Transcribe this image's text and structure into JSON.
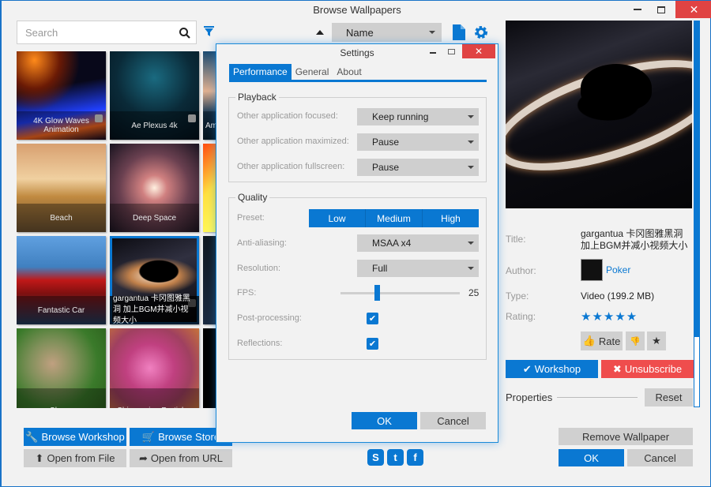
{
  "window": {
    "title": "Browse Wallpapers",
    "minimize_label": "–",
    "close_label": "✕"
  },
  "search": {
    "placeholder": "Search",
    "value": ""
  },
  "sort": {
    "selected": "Name"
  },
  "tiles": [
    {
      "label": "4K Glow Waves Animation",
      "workshop": true
    },
    {
      "label": "Ae Plexus 4k",
      "workshop": true
    },
    {
      "label": "Am...",
      "workshop": false
    },
    {
      "label": "Beach",
      "workshop": false
    },
    {
      "label": "Deep Space",
      "workshop": false
    },
    {
      "label": "",
      "workshop": false
    },
    {
      "label": "Fantastic Car",
      "workshop": false
    },
    {
      "label": "gargantua 卡冈图雅黑洞 加上BGM并减小视频大小",
      "workshop": true,
      "selected": true
    },
    {
      "label": "",
      "workshop": false
    },
    {
      "label": "Sheep",
      "workshop": false
    },
    {
      "label": "Shimmering Particles",
      "workshop": false
    },
    {
      "label": "",
      "workshop": false
    }
  ],
  "bottom_left": {
    "browse_workshop": "Browse Workshop",
    "browse_store": "Browse Store",
    "open_file": "Open from File",
    "open_url": "Open from URL"
  },
  "details": {
    "title_label": "Title:",
    "title_value": "gargantua 卡冈图雅黑洞 加上BGM并减小视频大小",
    "author_label": "Author:",
    "author_value": "Poker",
    "type_label": "Type:",
    "type_value": "Video (199.2 MB)",
    "rating_label": "Rating:",
    "rating_stars": 5,
    "stars_text": "★★★★★",
    "rate_label": "Rate",
    "workshop_label": "Workshop",
    "unsubscribe_label": "Unsubscribe",
    "properties_label": "Properties",
    "reset_label": "Reset"
  },
  "bottom_right": {
    "remove_wallpaper": "Remove Wallpaper",
    "ok": "OK",
    "cancel": "Cancel"
  },
  "social": [
    "steam",
    "twitter",
    "facebook"
  ],
  "settings": {
    "title": "Settings",
    "tabs": [
      "Performance",
      "General",
      "About"
    ],
    "active_tab": "Performance",
    "playback": {
      "title": "Playback",
      "rows": [
        {
          "label": "Other application focused:",
          "value": "Keep running"
        },
        {
          "label": "Other application maximized:",
          "value": "Pause"
        },
        {
          "label": "Other application fullscreen:",
          "value": "Pause"
        }
      ]
    },
    "quality": {
      "title": "Quality",
      "preset_label": "Preset:",
      "presets": [
        "Low",
        "Medium",
        "High"
      ],
      "antialiasing_label": "Anti-aliasing:",
      "antialiasing_value": "MSAA x4",
      "resolution_label": "Resolution:",
      "resolution_value": "Full",
      "fps_label": "FPS:",
      "fps_value": "25",
      "fps_slider_fraction": 0.31,
      "postprocessing_label": "Post-processing:",
      "postprocessing_checked": true,
      "reflections_label": "Reflections:",
      "reflections_checked": true
    },
    "ok": "OK",
    "cancel": "Cancel"
  },
  "colors": {
    "accent": "#0a78d2",
    "danger": "#ef4d4d",
    "close": "#e04343"
  }
}
